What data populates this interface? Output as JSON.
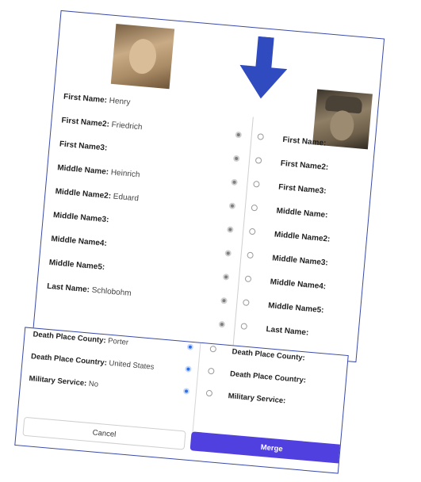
{
  "primary": {
    "rows": [
      {
        "label": "First Name",
        "value": "Henry"
      },
      {
        "label": "First Name2",
        "value": "Friedrich"
      },
      {
        "label": "First Name3",
        "value": ""
      },
      {
        "label": "Middle Name",
        "value": "Heinrich"
      },
      {
        "label": "Middle Name2",
        "value": "Eduard"
      },
      {
        "label": "Middle Name3",
        "value": ""
      },
      {
        "label": "Middle Name4",
        "value": ""
      },
      {
        "label": "Middle Name5",
        "value": ""
      },
      {
        "label": "Last Name",
        "value": "Schlobohm"
      }
    ]
  },
  "secondary": {
    "labels": [
      "First Name",
      "First Name2",
      "First Name3",
      "Middle Name",
      "Middle Name2",
      "Middle Name3",
      "Middle Name4",
      "Middle Name5",
      "Last Name"
    ]
  },
  "bottom": {
    "rows": [
      {
        "label": "Death Place County",
        "value": "Porter",
        "right_label": "Death Place County"
      },
      {
        "label": "Death Place Country",
        "value": "United States",
        "right_label": "Death Place Country"
      },
      {
        "label": "Military Service",
        "value": "No",
        "right_label": "Military Service"
      }
    ]
  },
  "buttons": {
    "cancel": "Cancel",
    "merge": "Merge"
  },
  "colors": {
    "accent": "#5140e0",
    "arrow": "#2f4bbf",
    "selected_radio": "#2f6fe0",
    "card_border": "#3a4aa8"
  },
  "icons": {
    "arrow": "down-arrow-icon",
    "photo_left": "person-photo",
    "photo_right": "person-photo"
  }
}
